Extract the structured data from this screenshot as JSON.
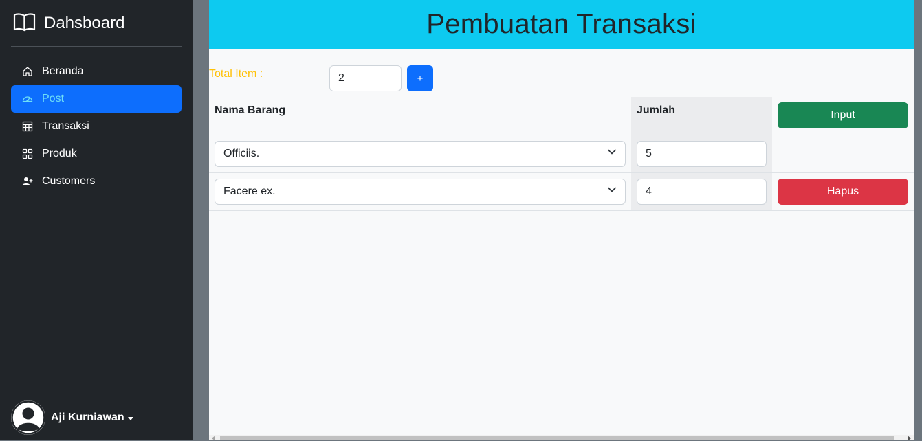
{
  "sidebar": {
    "brand": "Dahsboard",
    "items": [
      {
        "label": "Beranda",
        "icon": "house-icon"
      },
      {
        "label": "Post",
        "icon": "speedometer-icon",
        "active": true
      },
      {
        "label": "Transaksi",
        "icon": "table-icon"
      },
      {
        "label": "Produk",
        "icon": "grid-icon"
      },
      {
        "label": "Customers",
        "icon": "person-add-icon"
      }
    ],
    "user": {
      "name": "Aji Kurniawan"
    }
  },
  "main": {
    "title": "Pembuatan Transaksi",
    "total_item_label": "Total Item :",
    "total_item_value": "2",
    "add_label": "+",
    "table": {
      "headers": [
        "Nama Barang",
        "Jumlah"
      ],
      "input_label": "Input",
      "rows": [
        {
          "barang": "Officiis.",
          "jumlah": "5"
        },
        {
          "barang": "Facere ex.",
          "jumlah": "4",
          "delete_label": "Hapus"
        }
      ]
    }
  },
  "colors": {
    "sidebar_bg": "#212529",
    "primary": "#0d6efd",
    "header_bg": "#0dcaf0",
    "label_warning": "#ffc107",
    "success": "#198754",
    "danger": "#dc3545"
  }
}
